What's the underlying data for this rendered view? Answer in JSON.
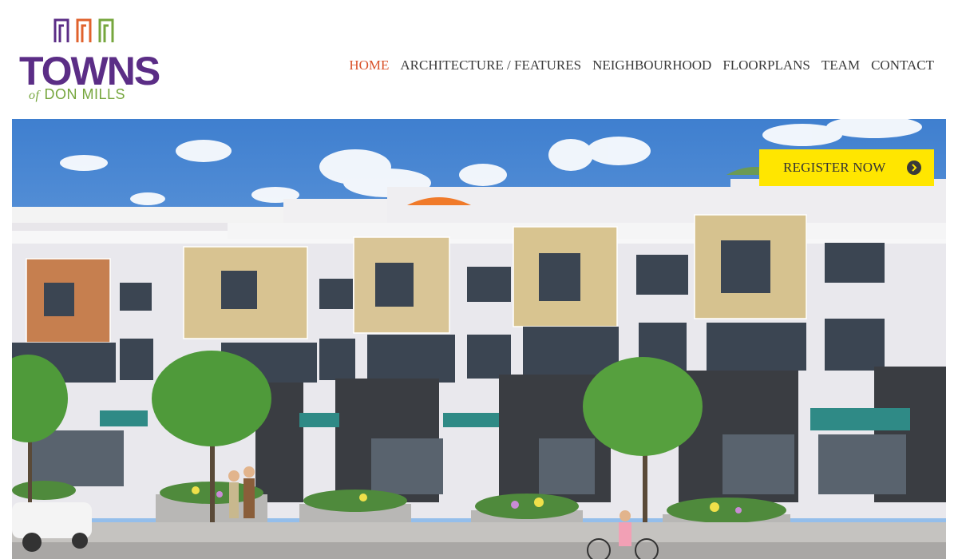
{
  "logo": {
    "title": "TOWNS",
    "of": "of",
    "subtitle": "DON MILLS",
    "colors": {
      "purple": "#5b2d86",
      "orange": "#e0622c",
      "green": "#76a63d"
    }
  },
  "nav": {
    "items": [
      {
        "label": "HOME",
        "active": true
      },
      {
        "label": "ARCHITECTURE / FEATURES",
        "active": false
      },
      {
        "label": "NEIGHBOURHOOD",
        "active": false
      },
      {
        "label": "FLOORPLANS",
        "active": false
      },
      {
        "label": "TEAM",
        "active": false
      },
      {
        "label": "CONTACT",
        "active": false
      }
    ],
    "active_color": "#d9522a"
  },
  "hero": {
    "image_alt": "Rendering of modern townhouses with street trees, people walking and cycling",
    "register_label": "REGISTER NOW",
    "register_color": "#ffe600",
    "register_icon": "chevron-right-circle-icon"
  }
}
